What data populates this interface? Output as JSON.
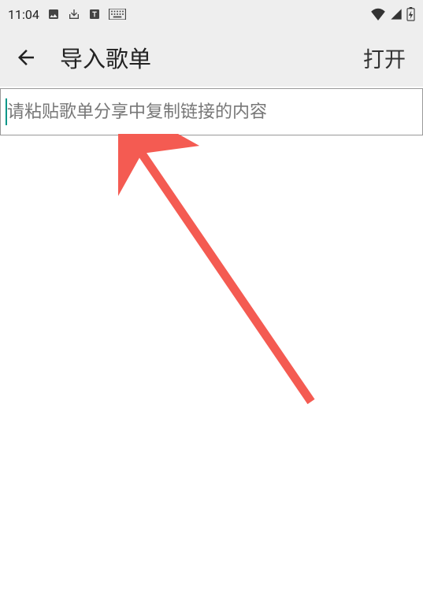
{
  "status_bar": {
    "time": "11:04"
  },
  "app_bar": {
    "title": "导入歌单",
    "action_label": "打开"
  },
  "input": {
    "placeholder": "请粘贴歌单分享中复制链接的内容",
    "value": ""
  }
}
